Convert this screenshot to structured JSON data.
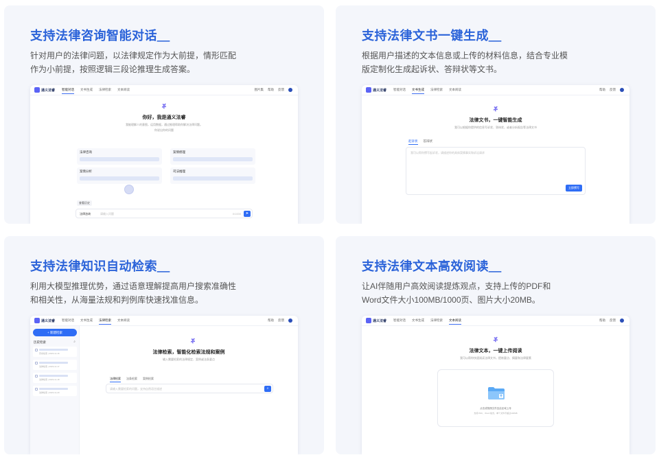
{
  "cards": [
    {
      "title": "支持法律咨询智能对话＿",
      "desc": "针对用户的法律问题，以法律规定作为大前提，情形匹配作为小前提，按照逻辑三段论推理生成答案。",
      "app": {
        "logo_text": "通义法睿",
        "nav": [
          "智能对话",
          "文书生成",
          "法律检索",
          "文本阅读"
        ],
        "nav_right": [
          "图片集",
          "帮助",
          "反馈"
        ],
        "hero_title": "你好，我是通义法睿",
        "hero_sub": "我能理解人的意图，运用数据，通过推理帮助你解决法律问题。",
        "hero_sub2": "你说出你的问题",
        "features": [
          "法律咨询",
          "案情梳理",
          "案情分析",
          "司法推理"
        ],
        "chip": "查看历史",
        "input_select": "法律咨询",
        "input_placeholder": "请输入问题",
        "input_count": "0/1000",
        "send_icon": "➤"
      }
    },
    {
      "title": "支持法律文书一键生成＿",
      "desc": "根据用户描述的文本信息或上传的材料信息，结合专业模版定制化生成起诉状、答辩状等文书。",
      "app": {
        "logo_text": "通义法睿",
        "nav": [
          "智能对话",
          "文书生成",
          "法律检索",
          "文本阅读"
        ],
        "nav_right": [
          "帮助",
          "反馈"
        ],
        "hero_title": "法律文书，一键智能生成",
        "hero_sub": "我可以根据你提供的信息写诉状、答辩状，或者分析报告等法律文书",
        "doc_tabs": [
          "起诉状",
          "答辩状"
        ],
        "doc_placeholder": "我可以帮你撰写起诉状，请描述你的具体案情事实和诉讼请求",
        "doc_button": "立即撰写"
      }
    },
    {
      "title": "支持法律知识自动检索＿",
      "desc": "利用大模型推理优势，通过语意理解提高用户搜索准确性和相关性，从海量法规和判例库快速找准信息。",
      "app": {
        "logo_text": "通义法睿",
        "nav": [
          "智能对话",
          "文书生成",
          "法律检索",
          "文本阅读"
        ],
        "nav_right": [
          "帮助",
          "反馈"
        ],
        "new_button": "+ 新建检索",
        "history_head": "历史检索",
        "history_meta": [
          "历史检索 | 2023-11-16",
          "法律检索 | 2023-11-17",
          "法律检索 | 2023-11-18",
          "法律检索 | 2023-11-20"
        ],
        "hero_title": "法律检索，智能化检索法规和案例",
        "hero_sub": "输入需要检索的法律规定、案例或法条要点",
        "search_tabs": [
          "法律检索",
          "法条检索",
          "案例检索"
        ],
        "search_placeholder": "请输入需要检索的问题，支持自然语言描述",
        "search_icon": "⌕"
      }
    },
    {
      "title": "支持法律文本高效阅读＿",
      "desc": "让AI伴随用户高效阅读提炼观点，支持上传的PDF和Word文件大小100MB/1000页、图片大小20MB。",
      "app": {
        "logo_text": "通义法睿",
        "nav": [
          "智能对话",
          "文书生成",
          "法律检索",
          "文本阅读"
        ],
        "nav_right": [
          "帮助",
          "反馈"
        ],
        "hero_title": "法律文本，一键上传阅读",
        "hero_sub": "我可以帮你快速阅读法律文书，提炼要点、摘要和法律要素",
        "upload_text": "点击或拖拽文件至此区域上传",
        "upload_hint": "支持 PDF、Word 格式，单个文件不超过100MB"
      }
    }
  ]
}
